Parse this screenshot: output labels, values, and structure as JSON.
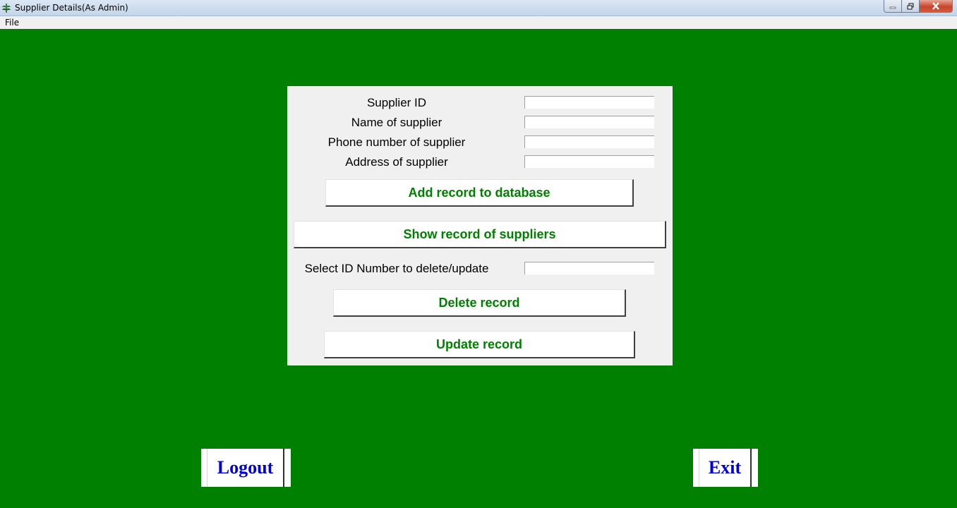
{
  "window": {
    "title": "Supplier Details(As Admin)",
    "minimize_icon": "minimize-icon",
    "maximize_icon": "restore-icon",
    "close_icon": "close-icon"
  },
  "menu": {
    "items": [
      "File"
    ]
  },
  "form": {
    "supplier_id_label": "Supplier ID",
    "supplier_id_value": "",
    "name_label": "Name of supplier",
    "name_value": "",
    "phone_label": "Phone number of supplier",
    "phone_value": "",
    "address_label": "Address of supplier",
    "address_value": "",
    "add_button": "Add record to database",
    "show_button": "Show record of suppliers",
    "select_id_label": "Select ID Number to delete/update",
    "select_id_value": "",
    "delete_button": "Delete record",
    "update_button": "Update record"
  },
  "footer": {
    "logout_button": "Logout",
    "exit_button": "Exit"
  },
  "colors": {
    "background": "#008000",
    "panel": "#f0f0f0",
    "button_text": "#008000",
    "footer_text": "#0000dd"
  }
}
